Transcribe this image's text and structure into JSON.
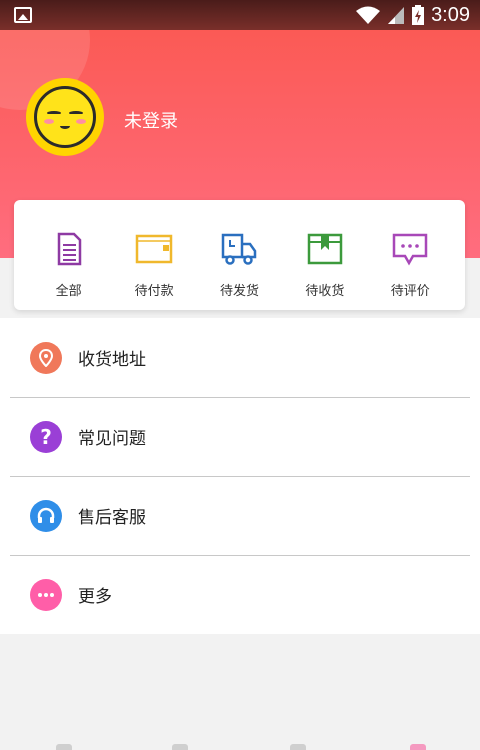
{
  "status_bar": {
    "time": "3:09"
  },
  "profile": {
    "login_label": "未登录"
  },
  "orders": [
    {
      "label": "全部",
      "icon": "document-icon",
      "color": "#8e3aa3"
    },
    {
      "label": "待付款",
      "icon": "wallet-icon",
      "color": "#f0b82c"
    },
    {
      "label": "待发货",
      "icon": "truck-icon",
      "color": "#2a6fbf"
    },
    {
      "label": "待收货",
      "icon": "package-icon",
      "color": "#3c9a3c"
    },
    {
      "label": "待评价",
      "icon": "comment-icon",
      "color": "#a848b8"
    }
  ],
  "menu": [
    {
      "label": "收货地址",
      "icon": "location-pin-icon",
      "color": "#f0785a"
    },
    {
      "label": "常见问题",
      "icon": "question-icon",
      "color": "#9a3fd6"
    },
    {
      "label": "售后客服",
      "icon": "headset-icon",
      "color": "#2f8ee8"
    },
    {
      "label": "更多",
      "icon": "more-icon",
      "color": "#ff5ea8"
    }
  ]
}
